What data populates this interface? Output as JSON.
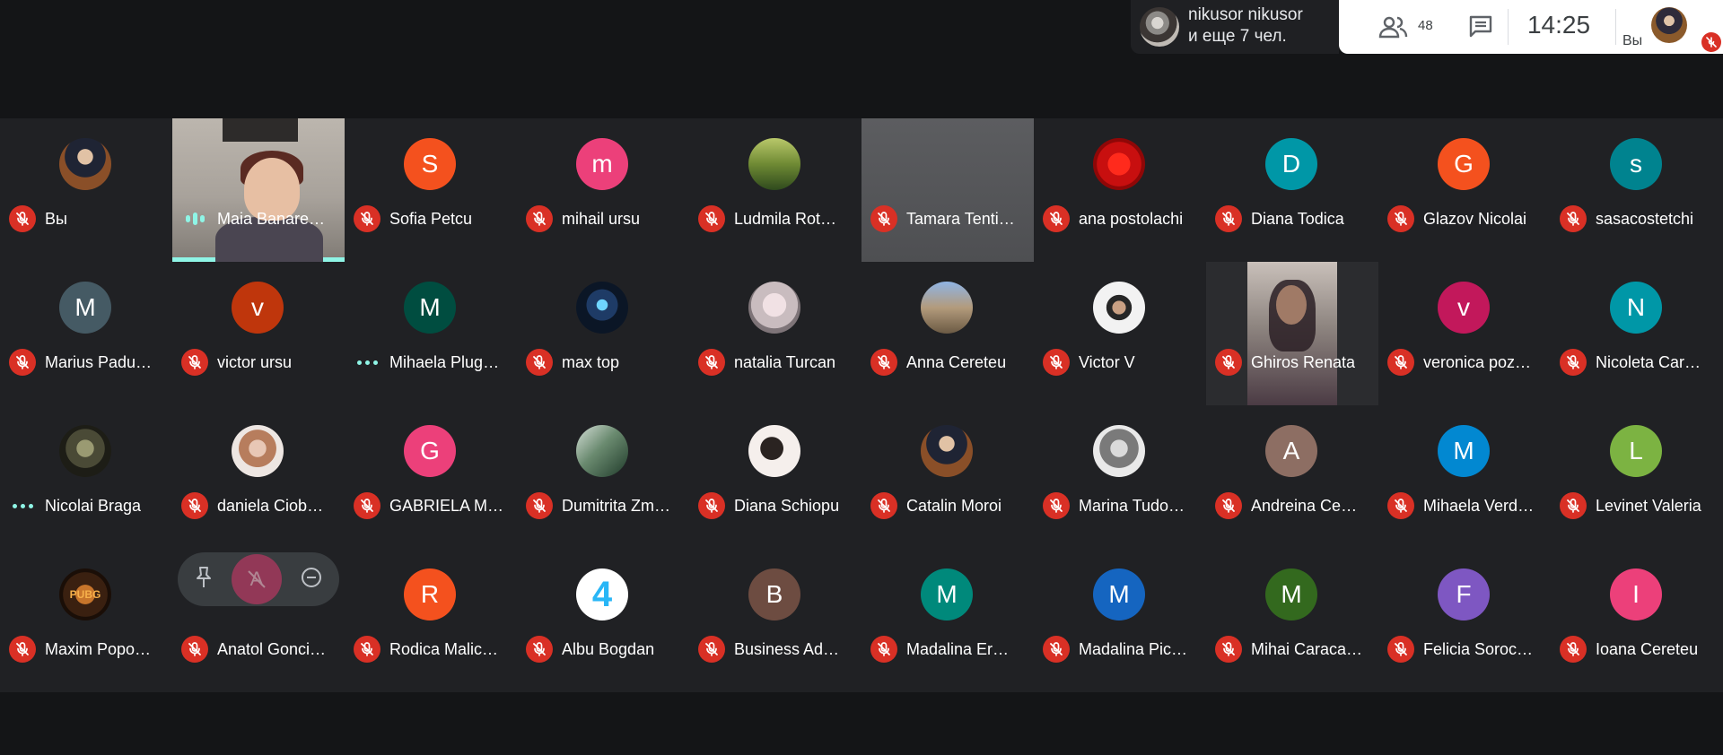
{
  "presenter": {
    "line1": "nikusor nikusor",
    "line2": "и еще 7 чел."
  },
  "controls": {
    "people_count": "48",
    "time": "14:25",
    "self_label": "Вы"
  },
  "colors": {
    "mic_off": "#d93025",
    "speaking": "#8ff5e6",
    "background": "#202124",
    "bar": "#141517"
  },
  "hover_controls": {
    "icons": [
      "pin-icon",
      "letter-a-icon",
      "remove-icon"
    ],
    "avatar_letter": "A"
  },
  "participants": [
    {
      "name": "Вы",
      "status": "muted",
      "avatar": "photo",
      "photo": "ph-self"
    },
    {
      "name": "Maia Banare…",
      "status": "speaking",
      "avatar": "video",
      "photo": "video-maia"
    },
    {
      "name": "Sofia Petcu",
      "status": "muted",
      "avatar": "letter",
      "letter": "S",
      "color": "#f4511e"
    },
    {
      "name": "mihail ursu",
      "status": "muted",
      "avatar": "letter",
      "letter": "m",
      "color": "#ec407a"
    },
    {
      "name": "Ludmila Rot…",
      "status": "muted",
      "avatar": "photo",
      "photo": "ph-ludmila"
    },
    {
      "name": "Tamara Tenti…",
      "status": "muted",
      "avatar": "video",
      "photo": "video-gray"
    },
    {
      "name": "ana postolachi",
      "status": "muted",
      "avatar": "photo",
      "photo": "ph-ana"
    },
    {
      "name": "Diana Todica",
      "status": "muted",
      "avatar": "letter",
      "letter": "D",
      "color": "#0097a7"
    },
    {
      "name": "Glazov Nicolai",
      "status": "muted",
      "avatar": "letter",
      "letter": "G",
      "color": "#f4511e"
    },
    {
      "name": "sasacostetchi",
      "status": "muted",
      "avatar": "letter",
      "letter": "s",
      "color": "#00838f"
    },
    {
      "name": "Marius Padu…",
      "status": "muted",
      "avatar": "letter",
      "letter": "M",
      "color": "#455a64"
    },
    {
      "name": "victor ursu",
      "status": "muted",
      "avatar": "letter",
      "letter": "v",
      "color": "#bf360c"
    },
    {
      "name": "Mihaela Plug…",
      "status": "dots",
      "avatar": "letter",
      "letter": "M",
      "color": "#004d40"
    },
    {
      "name": "max top",
      "status": "muted",
      "avatar": "photo",
      "photo": "ph-max"
    },
    {
      "name": "natalia Turcan",
      "status": "muted",
      "avatar": "photo",
      "photo": "ph-natalia"
    },
    {
      "name": "Anna Cereteu",
      "status": "muted",
      "avatar": "photo",
      "photo": "ph-anna"
    },
    {
      "name": "Victor V",
      "status": "muted",
      "avatar": "photo",
      "photo": "ph-victor"
    },
    {
      "name": "Ghiros Renata",
      "status": "muted",
      "avatar": "video",
      "photo": "video-ghiros"
    },
    {
      "name": "veronica poz…",
      "status": "muted",
      "avatar": "letter",
      "letter": "v",
      "color": "#c2185b"
    },
    {
      "name": "Nicoleta Car…",
      "status": "muted",
      "avatar": "letter",
      "letter": "N",
      "color": "#0097a7"
    },
    {
      "name": "Nicolai Braga",
      "status": "dots",
      "avatar": "photo",
      "photo": "ph-nicolai"
    },
    {
      "name": "daniela Ciob…",
      "status": "muted",
      "avatar": "photo",
      "photo": "ph-daniela"
    },
    {
      "name": "GABRIELA M…",
      "status": "muted",
      "avatar": "letter",
      "letter": "G",
      "color": "#ec407a"
    },
    {
      "name": "Dumitrita Zm…",
      "status": "muted",
      "avatar": "photo",
      "photo": "ph-dumitrita"
    },
    {
      "name": "Diana Schiopu",
      "status": "muted",
      "avatar": "photo",
      "photo": "ph-diana-s"
    },
    {
      "name": "Catalin Moroi",
      "status": "muted",
      "avatar": "photo",
      "photo": "ph-catalin"
    },
    {
      "name": "Marina Tudo…",
      "status": "muted",
      "avatar": "photo",
      "photo": "ph-marina"
    },
    {
      "name": "Andreina Ce…",
      "status": "muted",
      "avatar": "letter",
      "letter": "A",
      "color": "#8d6e63"
    },
    {
      "name": "Mihaela Verd…",
      "status": "muted",
      "avatar": "letter",
      "letter": "M",
      "color": "#0288d1"
    },
    {
      "name": "Levinet Valeria",
      "status": "muted",
      "avatar": "letter",
      "letter": "L",
      "color": "#7cb342"
    },
    {
      "name": "Maxim Popo…",
      "status": "muted",
      "avatar": "photo",
      "photo": "ph-maxim",
      "photo_text": "PUBG"
    },
    {
      "name": "Anatol Gonci…",
      "status": "muted",
      "avatar": "hover"
    },
    {
      "name": "Rodica Malic…",
      "status": "muted",
      "avatar": "letter",
      "letter": "R",
      "color": "#f4511e"
    },
    {
      "name": "Albu Bogdan",
      "status": "muted",
      "avatar": "photo",
      "photo": "ph-albu",
      "photo_text": "4"
    },
    {
      "name": "Business Ad…",
      "status": "muted",
      "avatar": "letter",
      "letter": "B",
      "color": "#6d4c41"
    },
    {
      "name": "Madalina Er…",
      "status": "muted",
      "avatar": "letter",
      "letter": "M",
      "color": "#00897b"
    },
    {
      "name": "Madalina Pic…",
      "status": "muted",
      "avatar": "letter",
      "letter": "M",
      "color": "#1565c0"
    },
    {
      "name": "Mihai Caraca…",
      "status": "muted",
      "avatar": "letter",
      "letter": "M",
      "color": "#33691e"
    },
    {
      "name": "Felicia Soroc…",
      "status": "muted",
      "avatar": "letter",
      "letter": "F",
      "color": "#7e57c2"
    },
    {
      "name": "Ioana Cereteu",
      "status": "muted",
      "avatar": "letter",
      "letter": "I",
      "color": "#ec407a"
    }
  ]
}
